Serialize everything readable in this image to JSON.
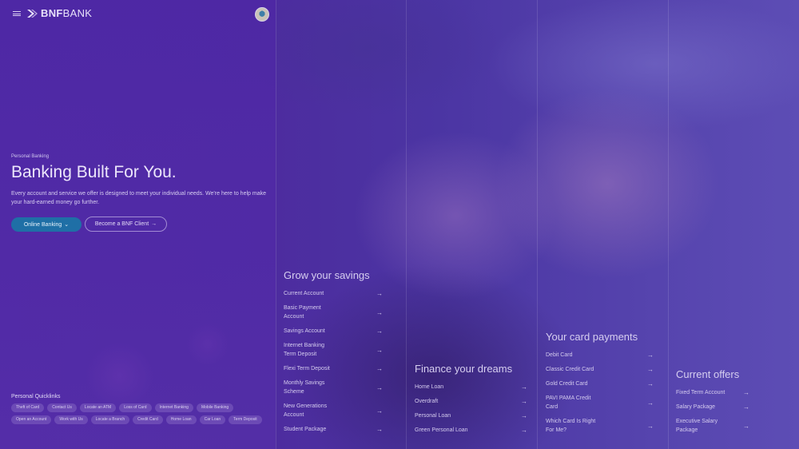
{
  "brand": {
    "name_bold": "BNF",
    "name_regular": "BANK"
  },
  "hero": {
    "eyebrow": "Personal Banking",
    "title": "Banking Built For You.",
    "description": "Every account and service we offer is designed to meet your individual needs. We're here to help make your hard-earned money go further.",
    "primary_button": "Online Banking",
    "secondary_button": "Become a BNF Client"
  },
  "quicklinks": {
    "title": "Personal Quicklinks",
    "items": [
      "Theft of Card",
      "Contact Us",
      "Locate an ATM",
      "Loss of Card",
      "Internet Banking",
      "Mobile Banking",
      "Open an Account",
      "Work with Us",
      "Locate a Branch",
      "Credit Card",
      "Home Loan",
      "Car Loan",
      "Term Deposit"
    ]
  },
  "columns": [
    {
      "title": "Grow your savings",
      "items": [
        [
          "Current Account"
        ],
        [
          "Basic Payment",
          "Account"
        ],
        [
          "Savings Account"
        ],
        [
          "Internet Banking",
          "Term Deposit"
        ],
        [
          "Flexi Term Deposit"
        ],
        [
          "Monthly Savings",
          "Scheme"
        ],
        [
          "New Generations",
          "Account"
        ],
        [
          "Student Package"
        ]
      ]
    },
    {
      "title": "Finance your dreams",
      "items": [
        [
          "Home Loan"
        ],
        [
          "Overdraft"
        ],
        [
          "Personal Loan"
        ],
        [
          "Green Personal Loan"
        ]
      ]
    },
    {
      "title": "Your card payments",
      "items": [
        [
          "Debit Card"
        ],
        [
          "Classic Credit Card"
        ],
        [
          "Gold Credit Card"
        ],
        [
          "PAVI PAMA Credit",
          "Card"
        ],
        [
          "Which Card Is Right",
          "For Me?"
        ]
      ]
    },
    {
      "title": "Current offers",
      "items": [
        [
          "Fixed Term Account"
        ],
        [
          "Salary Package"
        ],
        [
          "Executive Salary",
          "Package"
        ]
      ]
    }
  ],
  "colors": {
    "primary_button": "#1f6fa6",
    "overlay": "#4e28a5"
  }
}
